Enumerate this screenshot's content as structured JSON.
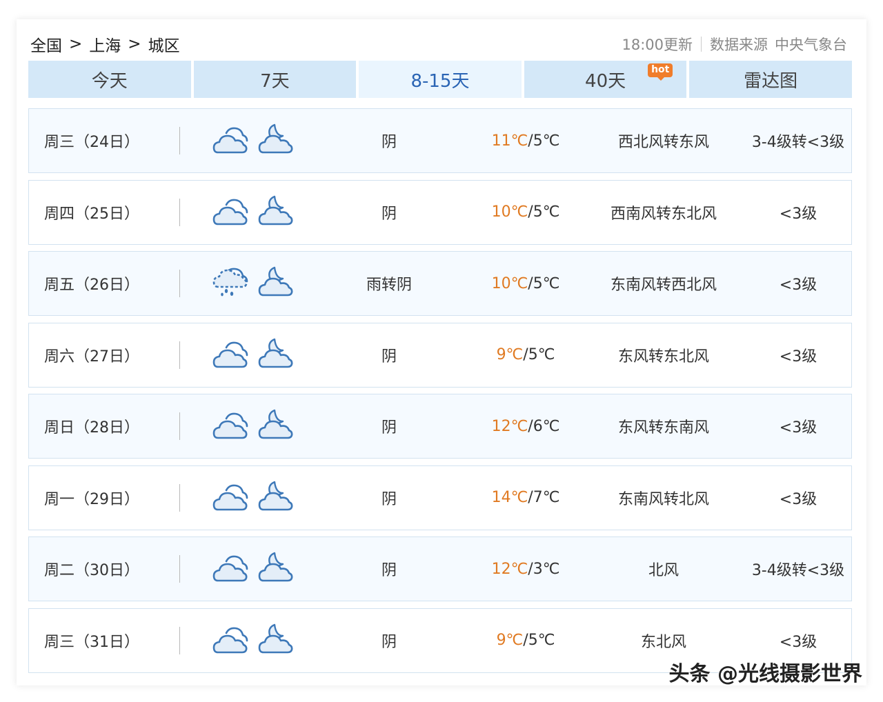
{
  "breadcrumb": {
    "country": "全国",
    "city": "上海",
    "district": "城区",
    "separator": ">"
  },
  "source": {
    "update_time": "18:00更新",
    "label": "数据来源",
    "org": "中央气象台"
  },
  "tabs": [
    {
      "label": "今天"
    },
    {
      "label": "7天"
    },
    {
      "label": "8-15天"
    },
    {
      "label": "40天",
      "badge": "hot"
    },
    {
      "label": "雷达图"
    }
  ],
  "active_tab": "8-15天",
  "colors": {
    "high_temp": "#e07a22",
    "active_tab": "#2a64b4",
    "tab_bg": "#d4e8f8",
    "badge": "#f07d2b"
  },
  "forecast": [
    {
      "date": "周三（24日）",
      "day_icon": "cloudy-icon",
      "night_icon": "cloudy-night-icon",
      "desc": "阴",
      "high": "11℃",
      "low": "5℃",
      "wind": "西北风转东风",
      "level": "3-4级转<3级"
    },
    {
      "date": "周四（25日）",
      "day_icon": "cloudy-icon",
      "night_icon": "cloudy-night-icon",
      "desc": "阴",
      "high": "10℃",
      "low": "5℃",
      "wind": "西南风转东北风",
      "level": "<3级"
    },
    {
      "date": "周五（26日）",
      "day_icon": "rain-icon",
      "night_icon": "cloudy-night-icon",
      "desc": "雨转阴",
      "high": "10℃",
      "low": "5℃",
      "wind": "东南风转西北风",
      "level": "<3级"
    },
    {
      "date": "周六（27日）",
      "day_icon": "cloudy-icon",
      "night_icon": "cloudy-night-icon",
      "desc": "阴",
      "high": "9℃",
      "low": "5℃",
      "wind": "东风转东北风",
      "level": "<3级"
    },
    {
      "date": "周日（28日）",
      "day_icon": "cloudy-icon",
      "night_icon": "cloudy-night-icon",
      "desc": "阴",
      "high": "12℃",
      "low": "6℃",
      "wind": "东风转东南风",
      "level": "<3级"
    },
    {
      "date": "周一（29日）",
      "day_icon": "cloudy-icon",
      "night_icon": "cloudy-night-icon",
      "desc": "阴",
      "high": "14℃",
      "low": "7℃",
      "wind": "东南风转北风",
      "level": "<3级"
    },
    {
      "date": "周二（30日）",
      "day_icon": "cloudy-icon",
      "night_icon": "cloudy-night-icon",
      "desc": "阴",
      "high": "12℃",
      "low": "3℃",
      "wind": "北风",
      "level": "3-4级转<3级"
    },
    {
      "date": "周三（31日）",
      "day_icon": "cloudy-icon",
      "night_icon": "cloudy-night-icon",
      "desc": "阴",
      "high": "9℃",
      "low": "5℃",
      "wind": "东北风",
      "level": "<3级"
    }
  ],
  "watermark": "头条 @光线摄影世界"
}
